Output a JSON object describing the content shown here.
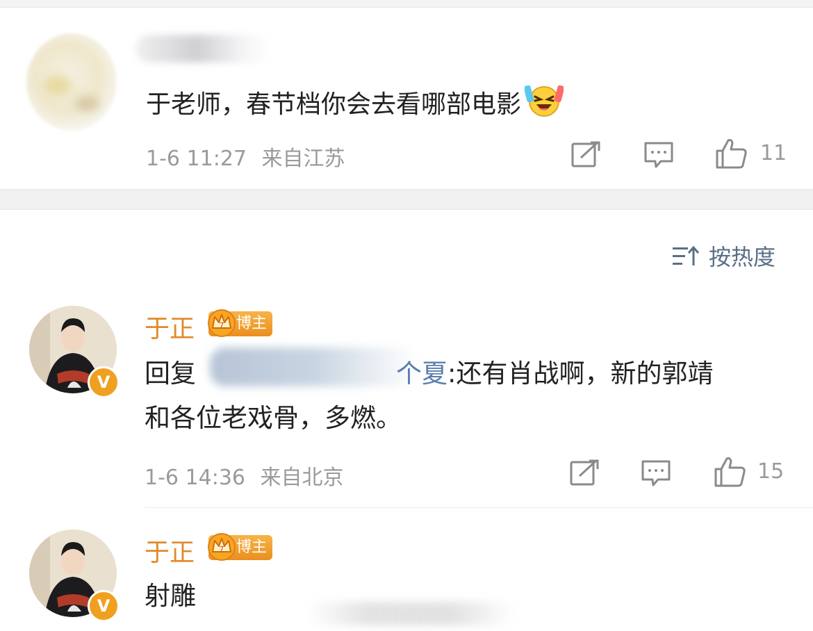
{
  "top_comment": {
    "text": "于老师，春节档你会去看哪部电影",
    "emoji_icon": "laughing-tears-emoji",
    "time": "1-6 11:27",
    "location": "来自江苏",
    "like_count": "11"
  },
  "sort": {
    "label": "按热度",
    "icon": "sort-icon"
  },
  "reply1": {
    "author": "于正",
    "badge": "博主",
    "verified_mark": "V",
    "reply_prefix": "回复",
    "mention_visible_tail": "个夏",
    "text_line1": ":还有肖战啊，新的郭靖",
    "text_line2": "和各位老戏骨，多燃。",
    "time": "1-6 14:36",
    "location": "来自北京",
    "like_count": "15"
  },
  "reply2": {
    "author": "于正",
    "badge": "博主",
    "verified_mark": "V",
    "text": "射雕"
  },
  "colors": {
    "name_orange": "#e08a2c",
    "link_blue": "#5a7fb0",
    "meta_gray": "#9a9a9a",
    "verified_orange": "#f0a020"
  }
}
